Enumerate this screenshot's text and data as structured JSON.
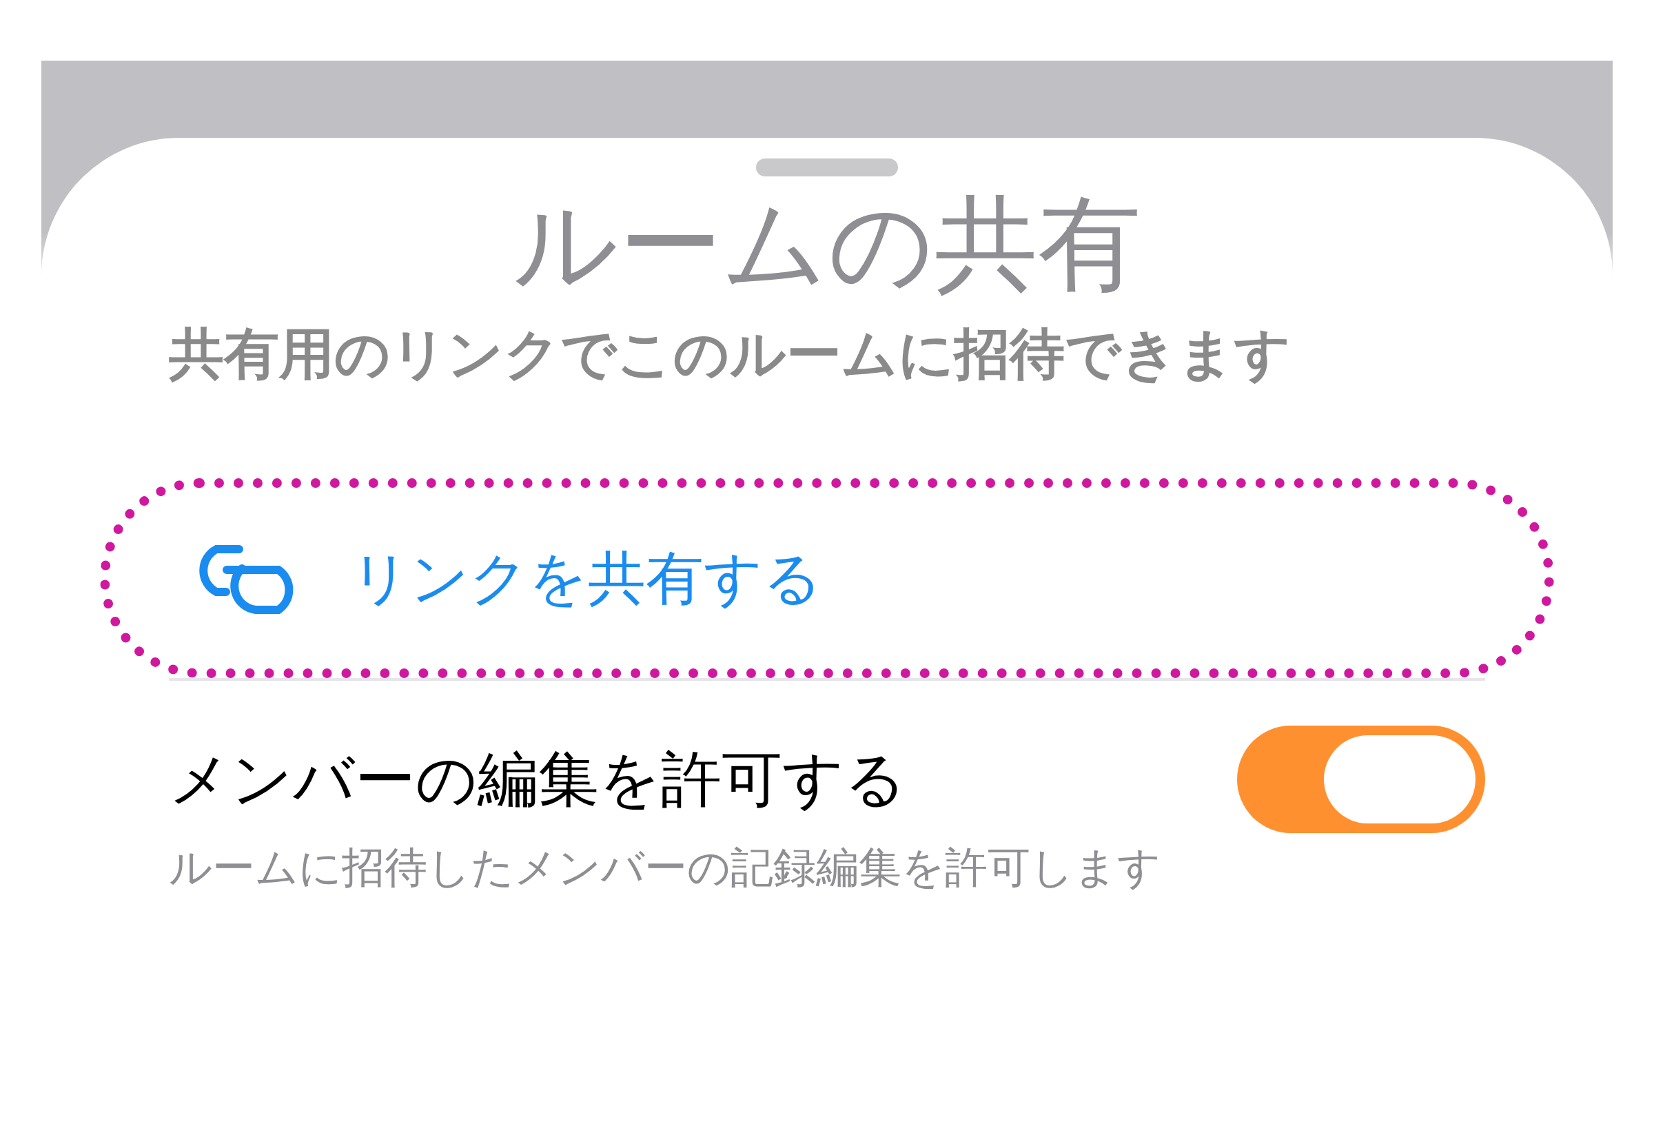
{
  "sheet": {
    "title": "ルームの共有",
    "subtitle": "共有用のリンクでこのルームに招待できます"
  },
  "share_link": {
    "label": "リンクを共有する",
    "highlighted": true
  },
  "allow_edit": {
    "label": "メンバーの編集を許可する",
    "description": "ルームに招待したメンバーの記録編集を許可します",
    "on": true
  }
}
